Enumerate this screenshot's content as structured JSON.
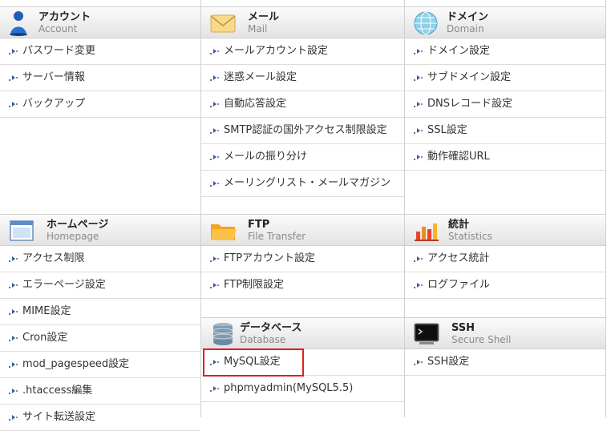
{
  "account": {
    "title": "アカウント",
    "subtitle": "Account",
    "items": [
      "パスワード変更",
      "サーバー情報",
      "バックアップ"
    ]
  },
  "mail": {
    "title": "メール",
    "subtitle": "Mail",
    "items": [
      "メールアカウント設定",
      "迷惑メール設定",
      "自動応答設定",
      "SMTP認証の国外アクセス制限設定",
      "メールの振り分け",
      "メーリングリスト・メールマガジン"
    ]
  },
  "domain": {
    "title": "ドメイン",
    "subtitle": "Domain",
    "items": [
      "ドメイン設定",
      "サブドメイン設定",
      "DNSレコード設定",
      "SSL設定",
      "動作確認URL"
    ]
  },
  "homepage": {
    "title": "ホームページ",
    "subtitle": "Homepage",
    "items": [
      "アクセス制限",
      "エラーページ設定",
      "MIME設定",
      "Cron設定",
      "mod_pagespeed設定",
      ".htaccess編集",
      "サイト転送設定"
    ]
  },
  "ftp": {
    "title": "FTP",
    "subtitle": "File Transfer",
    "items": [
      "FTPアカウント設定",
      "FTP制限設定"
    ]
  },
  "stats": {
    "title": "統計",
    "subtitle": "Statistics",
    "items": [
      "アクセス統計",
      "ログファイル"
    ]
  },
  "database": {
    "title": "データベース",
    "subtitle": "Database",
    "items": [
      "MySQL設定",
      "phpmyadmin(MySQL5.5)"
    ]
  },
  "ssh": {
    "title": "SSH",
    "subtitle": "Secure Shell",
    "items": [
      "SSH設定"
    ]
  },
  "colors": {
    "highlight": "#e21f1f"
  }
}
